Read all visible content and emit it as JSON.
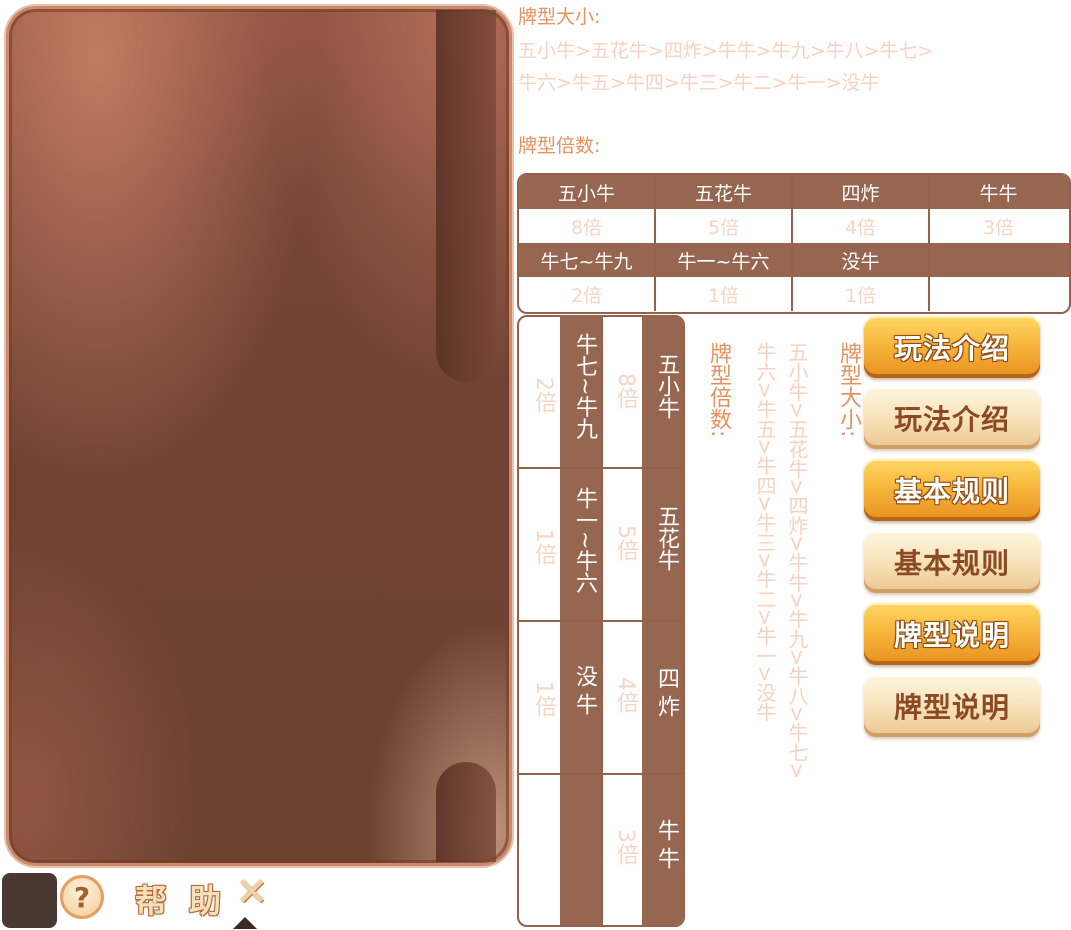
{
  "help": {
    "title": "帮助",
    "close_glyph": "✕",
    "help_glyph": "?"
  },
  "rank": {
    "heading": "牌型大小:",
    "line1": "五小牛>五花牛>四炸>牛牛>牛九>牛八>牛七>",
    "line2": "牛六>牛五>牛四>牛三>牛二>牛一>没牛",
    "vertical_line1": "五小牛>五花牛>四炸>牛牛>牛九>牛八>牛七>",
    "vertical_line2": "牛六>牛五>牛四>牛三>牛二>牛一>没牛"
  },
  "multiplier": {
    "heading": "牌型倍数:",
    "rows": [
      {
        "types": [
          "五小牛",
          "五花牛",
          "四炸",
          "牛牛"
        ],
        "values": [
          "8倍",
          "5倍",
          "4倍",
          "3倍"
        ]
      },
      {
        "types": [
          "牛七~牛九",
          "牛一~牛六",
          "没牛",
          ""
        ],
        "values": [
          "2倍",
          "1倍",
          "1倍",
          ""
        ]
      }
    ]
  },
  "menu": {
    "buttons": [
      {
        "label": "玩法介绍",
        "state": "active"
      },
      {
        "label": "玩法介绍",
        "state": "inactive"
      },
      {
        "label": "基本规则",
        "state": "active"
      },
      {
        "label": "基本规则",
        "state": "inactive"
      },
      {
        "label": "牌型说明",
        "state": "active"
      },
      {
        "label": "牌型说明",
        "state": "inactive"
      }
    ]
  },
  "colors": {
    "panel_brown": "#6f4232",
    "table_brown": "#966650",
    "heading_orange": "#e7915e",
    "faint_text": "#f7d2c2",
    "button_gold": "#f6b73b",
    "button_cream": "#f7e2bb"
  }
}
